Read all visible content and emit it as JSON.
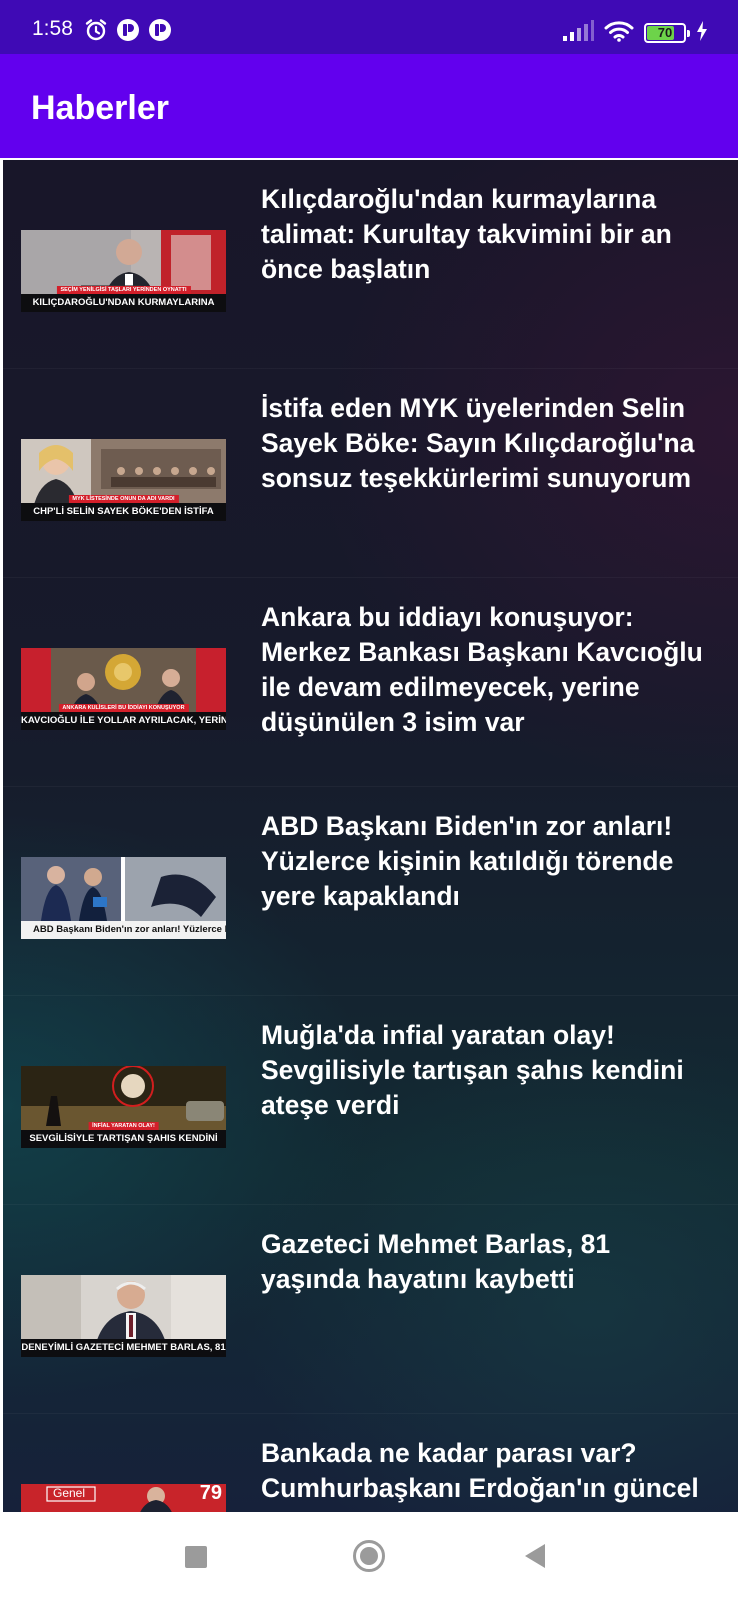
{
  "status_bar": {
    "time": "1:58",
    "battery_percent": "70",
    "icons_left": [
      "alarm-icon",
      "notification-app-icon",
      "notification-app-icon"
    ],
    "icons_right": [
      "signal-icon",
      "wifi-icon",
      "battery-icon",
      "charging-icon"
    ]
  },
  "app_bar": {
    "title": "Haberler"
  },
  "news": [
    {
      "headline": "Kılıçdaroğlu'ndan kurmaylarına\ntalimat: Kurultay takvimini bir an\nönce başlatın",
      "thumb_caption": "KILIÇDAROĞLU'NDAN KURMAYLARINA",
      "thumb_tag": "SEÇİM YENİLGİSİ TAŞLARI YERİNDEN OYNATTI"
    },
    {
      "headline": "İstifa eden MYK üyelerinden Selin\nSayek Böke: Sayın Kılıçdaroğlu'na\nsonsuz teşekkürlerimi sunuyorum",
      "thumb_caption": "CHP'Lİ SELİN SAYEK BÖKE'DEN İSTİFA",
      "thumb_tag": "MYK LİSTESİNDE ONUN DA ADI VARDI"
    },
    {
      "headline": "Ankara bu iddiayı konuşuyor:\nMerkez Bankası Başkanı Kavcıoğlu\nile devam edilmeyecek, yerine\ndüşünülen 3 isim var",
      "thumb_caption": "KAVCIOĞLU İLE YOLLAR AYRILACAK, YERİNE",
      "thumb_tag": "ANKARA KULİSLERİ BU İDDİAYI KONUŞUYOR"
    },
    {
      "headline": "ABD Başkanı Biden'ın zor anları!\nYüzlerce kişinin katıldığı törende\nyere kapaklandı",
      "thumb_caption": "ABD Başkanı Biden'ın zor anları! Yüzlerce kişinin",
      "thumb_tag": ""
    },
    {
      "headline": "Muğla'da infial yaratan olay!\nSevgilisiyle tartışan şahıs kendini\nateşe verdi",
      "thumb_caption": "SEVGİLİSİYLE TARTIŞAN ŞAHIS KENDİNİ",
      "thumb_tag": "İNFİAL YARATAN OLAY!"
    },
    {
      "headline": "Gazeteci Mehmet Barlas, 81\nyaşında hayatını kaybetti",
      "thumb_caption": "DENEYİMLİ GAZETECİ MEHMET BARLAS, 81",
      "thumb_tag": ""
    },
    {
      "headline": "Bankada ne kadar parası var?\nCumhurbaşkanı Erdoğan'ın güncel",
      "thumb_caption": "",
      "thumb_tag": "",
      "thumb_overlay_left": "Genel",
      "thumb_overlay_right": "79"
    }
  ],
  "nav_bar": {
    "buttons": [
      "recents-button",
      "home-button",
      "back-button"
    ]
  },
  "colors": {
    "status_bar": "#3f0ab5",
    "app_bar": "#6200ee",
    "list_background": "#171a2b",
    "headline_text": "#ffffff",
    "battery_fill": "#6dd34a",
    "nav_icons": "#9b9b9b"
  }
}
